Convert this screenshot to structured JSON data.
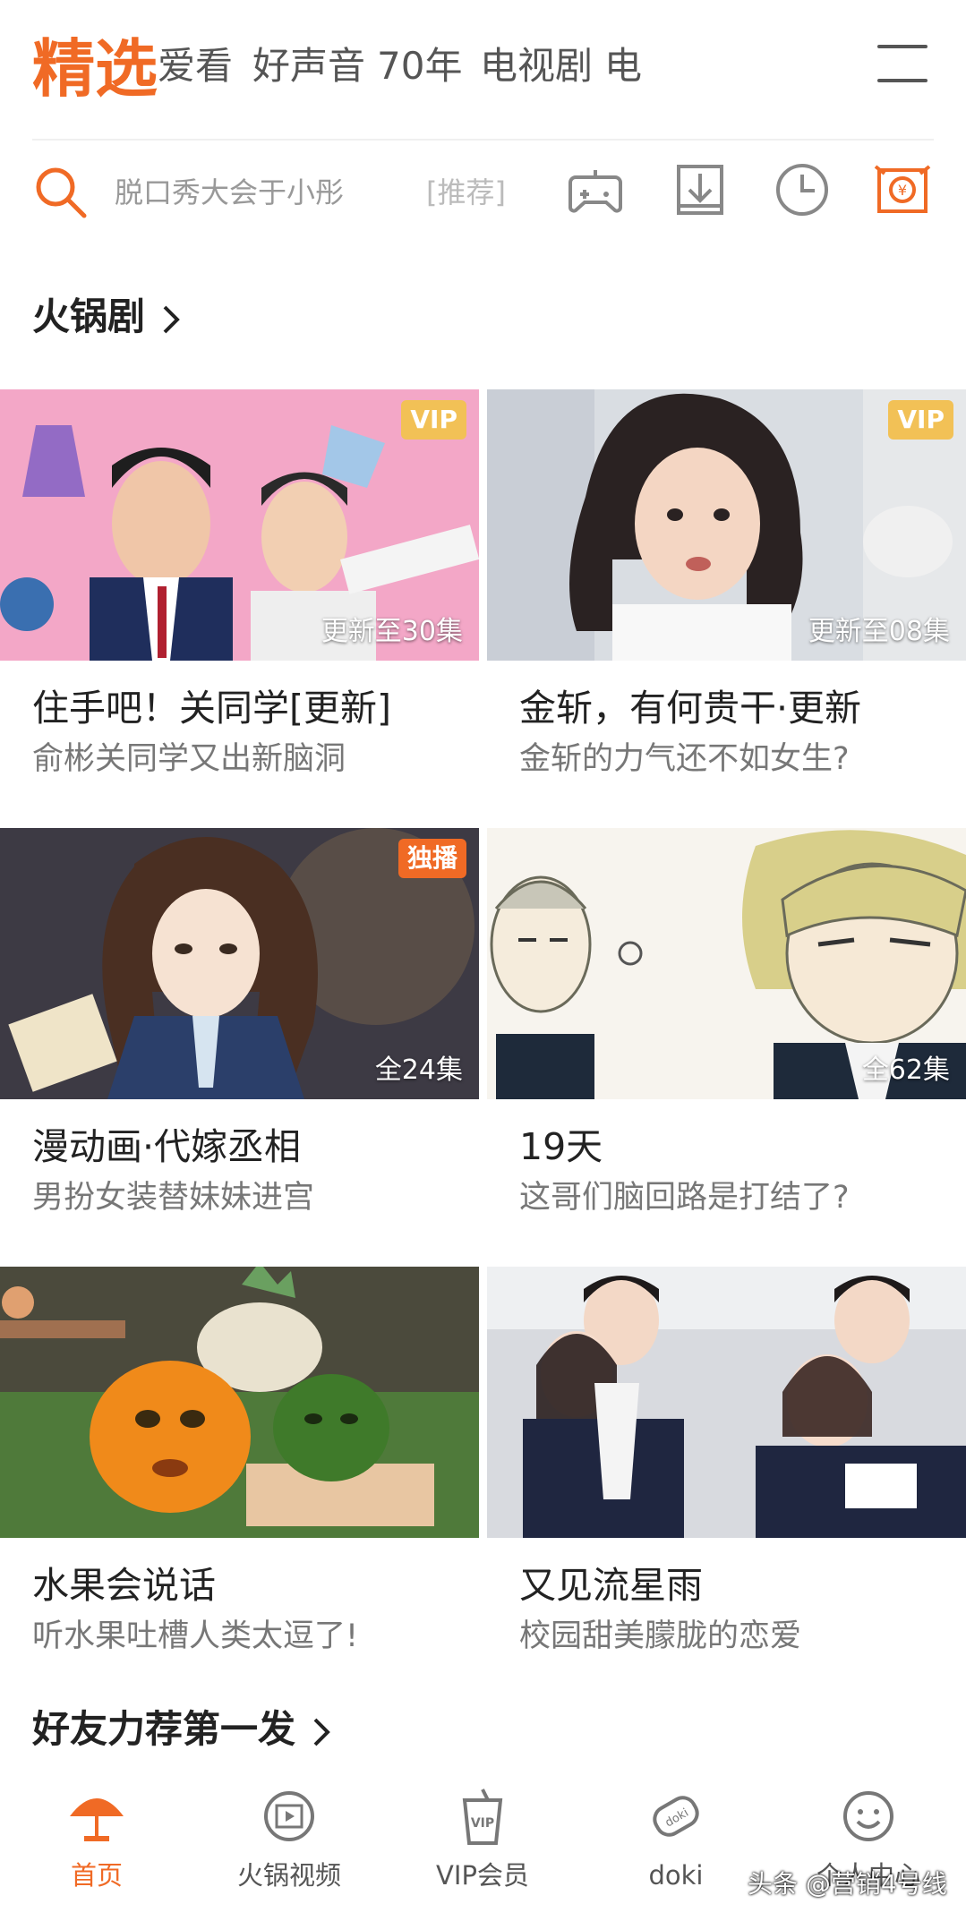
{
  "top_tabs": {
    "active": "精选",
    "items": [
      "爱看",
      "好声音",
      "70年",
      "电视剧"
    ]
  },
  "search": {
    "placeholder": "脱口秀大会于小彤",
    "tag": "[推荐]"
  },
  "toolbar_icons": [
    "game-controller-icon",
    "download-icon",
    "history-clock-icon",
    "vip-coin-icon"
  ],
  "section1": {
    "title": "火锅剧"
  },
  "cards": [
    {
      "title": "住手吧！关同学[更新]",
      "subtitle": "俞彬关同学又出新脑洞",
      "badge": "VIP",
      "episodes": "更新至30集"
    },
    {
      "title": "金斩，有何贵干·更新",
      "subtitle": "金斩的力气还不如女生?",
      "badge": "VIP",
      "episodes": "更新至08集"
    },
    {
      "title": "漫动画·代嫁丞相",
      "subtitle": "男扮女装替妹妹进宫",
      "badge": "独播",
      "episodes": "全24集"
    },
    {
      "title": "19天",
      "subtitle": "这哥们脑回路是打结了?",
      "badge": "",
      "episodes": "全62集"
    },
    {
      "title": "水果会说话",
      "subtitle": "听水果吐槽人类太逗了!",
      "badge": "",
      "episodes": ""
    },
    {
      "title": "又见流星雨",
      "subtitle": "校园甜美朦胧的恋爱",
      "badge": "",
      "episodes": ""
    }
  ],
  "section2": {
    "title": "好友力荐第一发"
  },
  "bottom_nav": [
    {
      "label": "首页",
      "icon": "umbrella-home-icon",
      "active": true
    },
    {
      "label": "火锅视频",
      "icon": "film-reel-icon",
      "active": false
    },
    {
      "label": "VIP会员",
      "icon": "vip-cup-icon",
      "active": false
    },
    {
      "label": "doki",
      "icon": "doki-tag-icon",
      "active": false
    },
    {
      "label": "个人中心",
      "icon": "smiley-profile-icon",
      "active": false
    }
  ],
  "watermark": "头条 @营销4号线",
  "colors": {
    "accent": "#f06a25",
    "vip": "#f2c156",
    "text": "#222222",
    "subtext": "#777777"
  }
}
